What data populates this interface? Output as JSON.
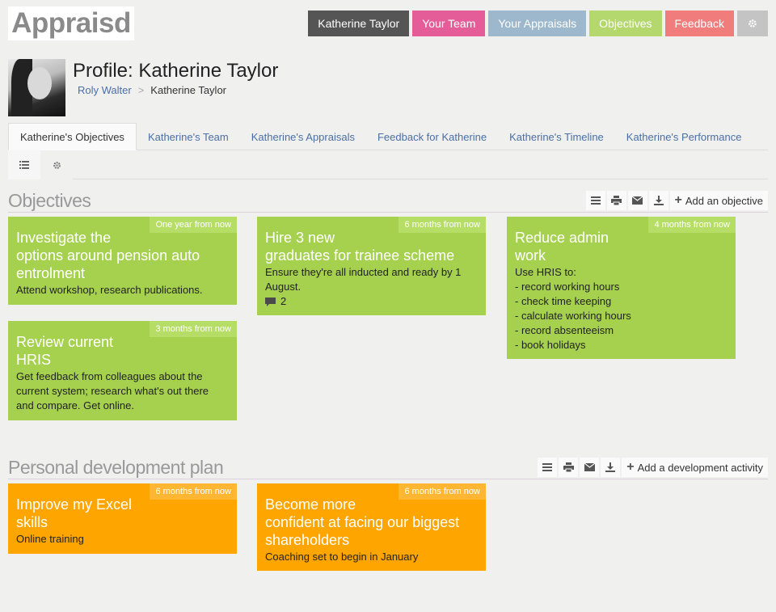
{
  "logo": "Appraisd",
  "nav": {
    "user": "Katherine Taylor",
    "team": "Your Team",
    "appraisals": "Your Appraisals",
    "objectives": "Objectives",
    "feedback": "Feedback",
    "settings_icon": "gear-icon"
  },
  "profile": {
    "title": "Profile: Katherine Taylor",
    "breadcrumb_parent": "Roly Walter",
    "breadcrumb_sep": ">",
    "breadcrumb_current": "Katherine Taylor"
  },
  "tabs": [
    "Katherine's Objectives",
    "Katherine's Team",
    "Katherine's Appraisals",
    "Feedback for Katherine",
    "Katherine's Timeline",
    "Katherine's Performance"
  ],
  "objectives_section": {
    "title": "Objectives",
    "add_label": "Add an objective",
    "cards": [
      {
        "due": "One year from now",
        "title": "Investigate the\noptions around pension auto\nentrolment",
        "desc": "Attend workshop, research publications."
      },
      {
        "due": "6 months from now",
        "title": "Hire 3 new\ngraduates for trainee scheme",
        "desc": "Ensure they're all inducted and ready by 1\nAugust.",
        "comments": "2"
      },
      {
        "due": "4 months from now",
        "title": "Reduce admin\nwork",
        "desc": "Use HRIS to:\n- record working hours\n- check time keeping\n- calculate working hours\n- record absenteeism\n- book holidays"
      },
      {
        "due": "3 months from now",
        "title": "Review current\nHRIS",
        "desc": "Get feedback from colleagues about the\ncurrent system; research what's out there\nand compare. Get online."
      }
    ]
  },
  "pdp_section": {
    "title": "Personal development plan",
    "add_label": "Add a development activity",
    "cards": [
      {
        "due": "6 months from now",
        "title": "Improve my Excel\nskills",
        "desc": "Online training"
      },
      {
        "due": "6 months from now",
        "title": "Become more\nconfident at facing our biggest\nshareholders",
        "desc": "Coaching set to begin in January"
      }
    ]
  },
  "colors": {
    "objective_card": "#a6d14f",
    "development_card": "#ffa500",
    "link": "#4a6fa5"
  }
}
